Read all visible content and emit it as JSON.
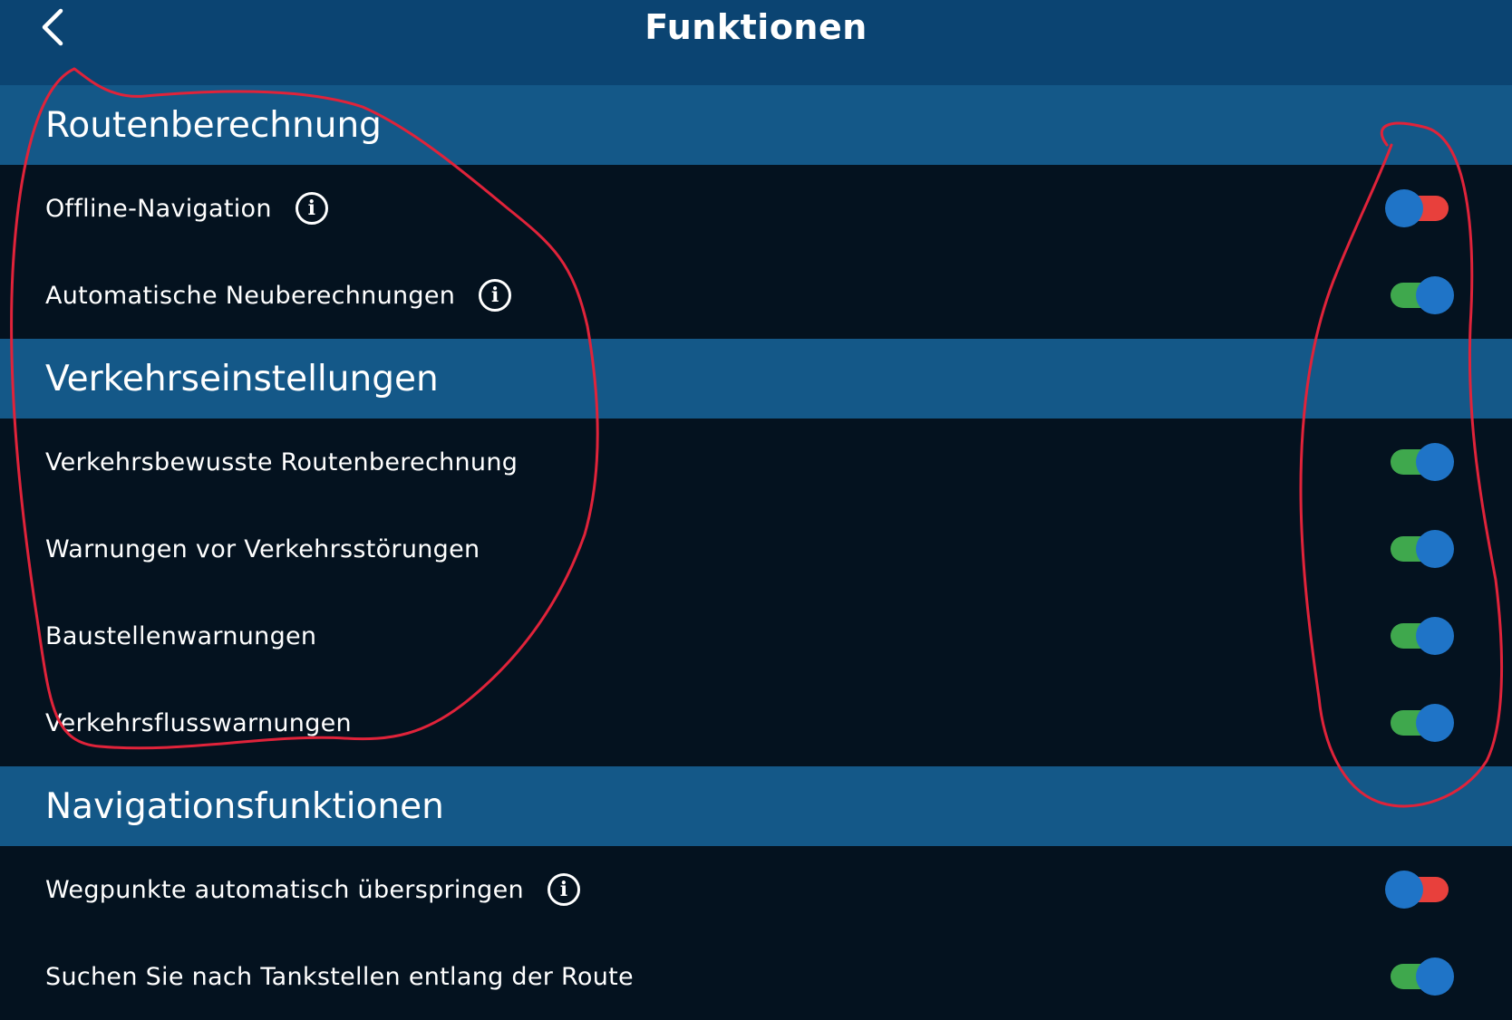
{
  "header": {
    "title": "Funktionen",
    "back_icon": "chevron-left-icon"
  },
  "colors": {
    "header_bg": "#0b4472",
    "section_bg": "#145888",
    "row_bg": "#04121f",
    "toggle_on_track": "#3fa84d",
    "toggle_off_track": "#e8403c",
    "toggle_knob": "#1f74c7",
    "annotation_ink": "#e0233a"
  },
  "sections": [
    {
      "title": "Routenberechnung",
      "items": [
        {
          "label": "Offline-Navigation",
          "info": true,
          "enabled": false
        },
        {
          "label": "Automatische Neuberechnungen",
          "info": true,
          "enabled": true
        }
      ]
    },
    {
      "title": "Verkehrseinstellungen",
      "items": [
        {
          "label": "Verkehrsbewusste Routenberechnung",
          "info": false,
          "enabled": true
        },
        {
          "label": "Warnungen vor Verkehrsstörungen",
          "info": false,
          "enabled": true
        },
        {
          "label": "Baustellenwarnungen",
          "info": false,
          "enabled": true
        },
        {
          "label": "Verkehrsflusswarnungen",
          "info": false,
          "enabled": true
        }
      ]
    },
    {
      "title": "Navigationsfunktionen",
      "items": [
        {
          "label": "Wegpunkte automatisch überspringen",
          "info": true,
          "enabled": false
        },
        {
          "label": "Suchen Sie nach Tankstellen entlang der Route",
          "info": false,
          "enabled": true
        }
      ]
    }
  ]
}
